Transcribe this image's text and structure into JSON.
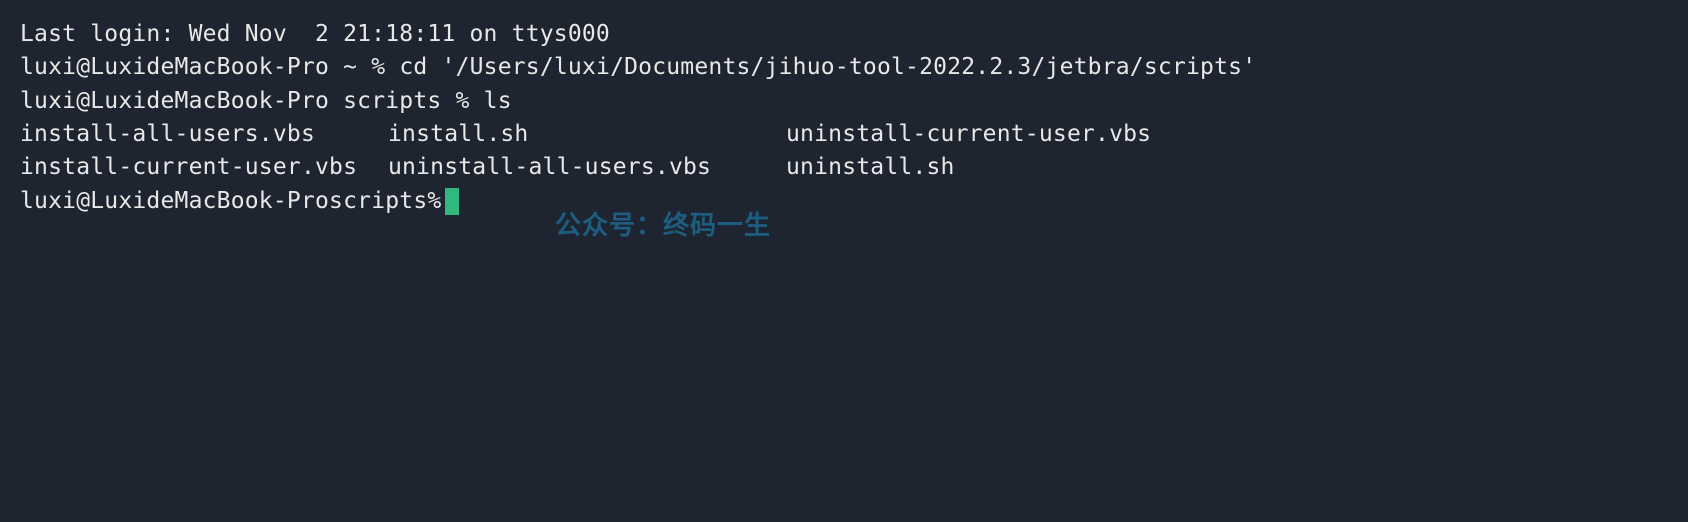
{
  "terminal": {
    "last_login": "Last login: Wed Nov  2 21:18:11 on ttys000",
    "prompt1_user_host": "luxi@LuxideMacBook-Pro",
    "prompt1_dir": "~",
    "prompt1_symbol": "%",
    "cmd1": "cd '/Users/luxi/Documents/jihuo-tool-2022.2.3/jetbra/scripts'",
    "prompt2_user_host": "luxi@LuxideMacBook-Pro",
    "prompt2_dir": "scripts",
    "prompt2_symbol": "%",
    "cmd2": "ls",
    "ls_items": {
      "r0c0": "install-all-users.vbs",
      "r0c1": "install.sh",
      "r0c2": "uninstall-current-user.vbs",
      "r1c0": "install-current-user.vbs",
      "r1c1": "uninstall-all-users.vbs",
      "r1c2": "uninstall.sh"
    },
    "prompt3_user_host": "luxi@LuxideMacBook-Pro",
    "prompt3_dir": "scripts",
    "prompt3_symbol": "%"
  },
  "watermark": "公众号：终码一生"
}
